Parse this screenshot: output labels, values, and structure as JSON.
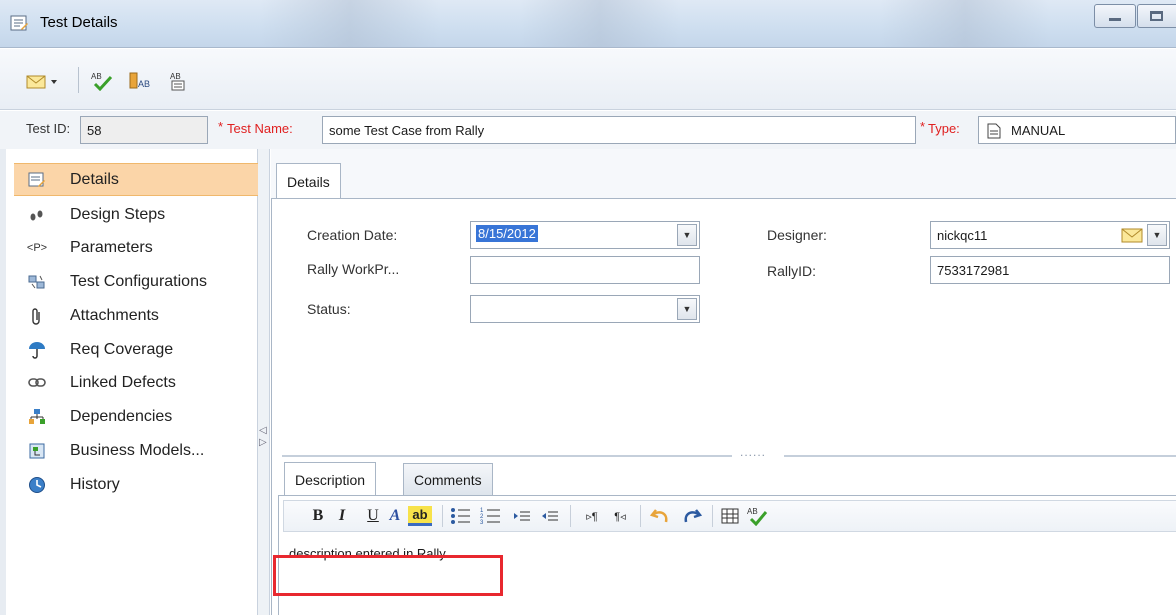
{
  "window": {
    "title": "Test Details"
  },
  "fields": {
    "test_id_label": "Test ID:",
    "test_id_value": "58",
    "test_name_req": "*",
    "test_name_label": "Test Name:",
    "test_name_value": "some Test Case from Rally",
    "type_req": "*",
    "type_label": "Type:",
    "type_value": "MANUAL"
  },
  "sidebar": {
    "items": [
      {
        "label": "Details",
        "icon": "details-icon"
      },
      {
        "label": "Design Steps",
        "icon": "design-steps-icon"
      },
      {
        "label": "Parameters",
        "icon": "parameters-icon"
      },
      {
        "label": "Test Configurations",
        "icon": "configurations-icon"
      },
      {
        "label": "Attachments",
        "icon": "paperclip-icon"
      },
      {
        "label": "Req Coverage",
        "icon": "umbrella-icon"
      },
      {
        "label": "Linked Defects",
        "icon": "link-icon"
      },
      {
        "label": "Dependencies",
        "icon": "dependencies-icon"
      },
      {
        "label": "Business Models...",
        "icon": "business-models-icon"
      },
      {
        "label": "History",
        "icon": "history-icon"
      }
    ],
    "active_index": 0,
    "parameters_glyph": "<P>"
  },
  "main": {
    "tab": "Details",
    "form": {
      "creation_date_label": "Creation Date:",
      "creation_date_value": "8/15/2012",
      "rally_workpr_label": "Rally WorkPr...",
      "rally_workpr_value": "",
      "status_label": "Status:",
      "status_value": "",
      "designer_label": "Designer:",
      "designer_value": "nickqc11",
      "rallyid_label": "RallyID:",
      "rallyid_value": "7533172981"
    },
    "splitter_dots": "......",
    "bottom_tabs": [
      "Description",
      "Comments"
    ],
    "editor": {
      "bold": "B",
      "italic": "I",
      "underline": "U",
      "font_color": "A",
      "highlight": "ab",
      "description_text": "description entered in Rally."
    }
  },
  "colors": {
    "active_item": "#fbd5a8",
    "highlight_box": "#e8282f",
    "required": "#e02020",
    "selection": "#3875d7"
  }
}
